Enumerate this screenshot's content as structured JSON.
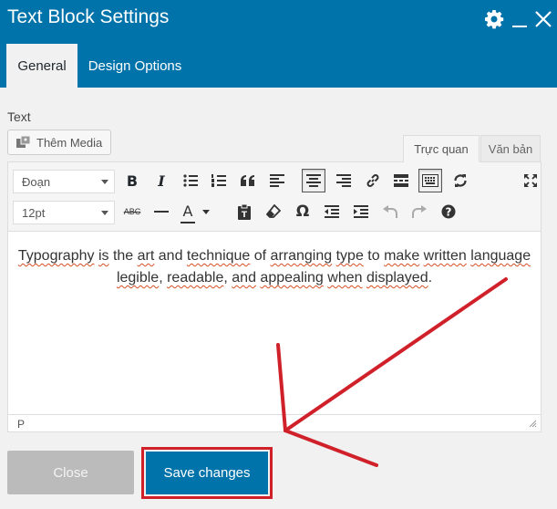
{
  "dialog": {
    "title": "Text Block Settings",
    "icons": {
      "settings": "gear-icon",
      "minimize": "minimize-icon",
      "close": "close-icon"
    }
  },
  "tabs": [
    {
      "label": "General",
      "active": true
    },
    {
      "label": "Design Options",
      "active": false
    }
  ],
  "field": {
    "label": "Text"
  },
  "media_button": {
    "label": "Thêm Media",
    "icon": "media-icon"
  },
  "editor_tabs": [
    {
      "label": "Trực quan",
      "active": true
    },
    {
      "label": "Văn bản",
      "active": false
    }
  ],
  "toolbar": {
    "format_select": "Đoạn",
    "size_select": "12pt",
    "row1": [
      "bold-icon",
      "italic-icon",
      "bullet-list-icon",
      "numbered-list-icon",
      "blockquote-icon",
      "align-left-icon",
      "align-center-icon",
      "align-right-icon",
      "link-icon",
      "read-more-icon",
      "toolbar-toggle-icon",
      "refresh-icon",
      "fullscreen-icon"
    ],
    "row2": [
      "strikethrough-icon",
      "horizontal-line-icon",
      "text-color-icon",
      "paste-text-icon",
      "clear-format-icon",
      "special-char-icon",
      "outdent-icon",
      "indent-icon",
      "undo-icon",
      "redo-icon",
      "help-icon"
    ],
    "bold_label": "B",
    "italic_label": "I",
    "strike_label": "ABC",
    "text_color_label": "A",
    "special_char_label": "Ω"
  },
  "content": {
    "line1": [
      "Typography",
      " ",
      "is",
      " the ",
      "art",
      " and ",
      "technique",
      " of ",
      "arranging",
      " ",
      "type",
      " to ",
      "make",
      " ",
      "written",
      " ",
      "language"
    ],
    "line2": [
      "legible",
      ", ",
      "readable",
      ", ",
      "and",
      " ",
      "appealing",
      " ",
      "when",
      " ",
      "displayed",
      "."
    ],
    "text": "Typography is the art and technique of arranging type to make written language legible, readable, and appealing when displayed."
  },
  "status_path": "P",
  "buttons": {
    "close": "Close",
    "save": "Save changes"
  },
  "colors": {
    "header": "#0073aa",
    "annotation": "#d0212a",
    "close_button": "#bbbbbb",
    "save_button": "#0073aa"
  }
}
